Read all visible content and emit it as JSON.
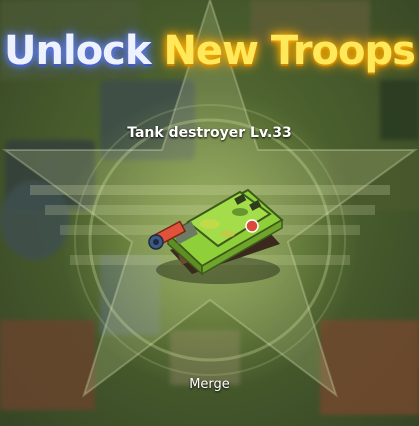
{
  "title": {
    "part1": "Unlock",
    "part2": "New Troops"
  },
  "unit": {
    "name": "Tank destroyer Lv.33",
    "icon": "tank-destroyer-icon"
  },
  "action": {
    "merge_label": "Merge"
  },
  "colors": {
    "title_white": "#eef2ff",
    "title_yellow": "#ffe85a",
    "tank_body": "#8fcf3a",
    "tank_barrel": "#e0523a"
  }
}
